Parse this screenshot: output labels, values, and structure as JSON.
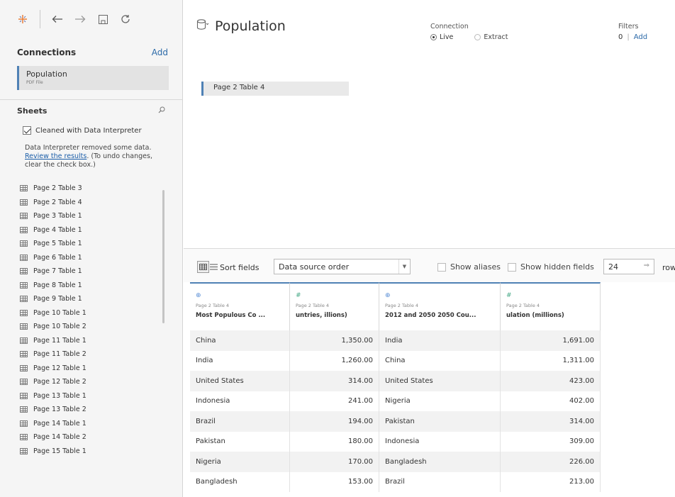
{
  "toolbar": {
    "icons": [
      "tableau-logo-icon",
      "back-arrow-icon",
      "forward-arrow-icon",
      "save-icon",
      "refresh-icon"
    ]
  },
  "connections": {
    "title": "Connections",
    "add_label": "Add",
    "item": {
      "name": "Population",
      "type": "PDF File"
    }
  },
  "sheets": {
    "title": "Sheets",
    "interpreter_label": "Cleaned with Data Interpreter",
    "interpreter_checked": true,
    "note_before": "Data Interpreter removed some data. ",
    "note_link": "Review the results",
    "note_after": ". (To undo changes, clear the check box.)",
    "items": [
      "Page  2 Table 3",
      "Page  2 Table 4",
      "Page  3 Table 1",
      "Page  4 Table 1",
      "Page  5 Table 1",
      "Page  6 Table 1",
      "Page  7 Table 1",
      "Page  8 Table 1",
      "Page  9 Table 1",
      "Page 10 Table 1",
      "Page 10 Table 2",
      "Page 11 Table 1",
      "Page 11 Table 2",
      "Page 12 Table 1",
      "Page 12 Table 2",
      "Page 13 Table 1",
      "Page 13 Table 2",
      "Page 14 Table 1",
      "Page 14 Table 2",
      "Page 15 Table 1"
    ]
  },
  "datasource": {
    "title": "Population",
    "connection_label": "Connection",
    "live_label": "Live",
    "extract_label": "Extract",
    "live_selected": true,
    "filters_label": "Filters",
    "filters_count": "0",
    "filters_add": "Add",
    "canvas_table": "Page   2 Table 4"
  },
  "grid_toolbar": {
    "sort_label": "Sort fields",
    "sort_value": "Data source order",
    "show_aliases": "Show aliases",
    "show_hidden": "Show hidden fields",
    "rows_value": "24",
    "rows_label": "rows"
  },
  "grid": {
    "columns": [
      {
        "type": "globe-icon",
        "source": "Page  2 Table 4",
        "name": "Most Populous Co ..."
      },
      {
        "type": "number-icon",
        "source": "Page  2 Table 4",
        "name": "untries, illions)"
      },
      {
        "type": "globe-icon",
        "source": "Page  2 Table 4",
        "name": "2012 and 2050 2050 Cou..."
      },
      {
        "type": "number-icon",
        "source": "Page  2 Table 4",
        "name": "ulation (millions)"
      }
    ],
    "rows": [
      [
        "China",
        "1,350.00",
        "India",
        "1,691.00"
      ],
      [
        "India",
        "1,260.00",
        "China",
        "1,311.00"
      ],
      [
        "United States",
        "314.00",
        "United States",
        "423.00"
      ],
      [
        "Indonesia",
        "241.00",
        "Nigeria",
        "402.00"
      ],
      [
        "Brazil",
        "194.00",
        "Pakistan",
        "314.00"
      ],
      [
        "Pakistan",
        "180.00",
        "Indonesia",
        "309.00"
      ],
      [
        "Nigeria",
        "170.00",
        "Bangladesh",
        "226.00"
      ],
      [
        "Bangladesh",
        "153.00",
        "Brazil",
        "213.00"
      ]
    ]
  }
}
